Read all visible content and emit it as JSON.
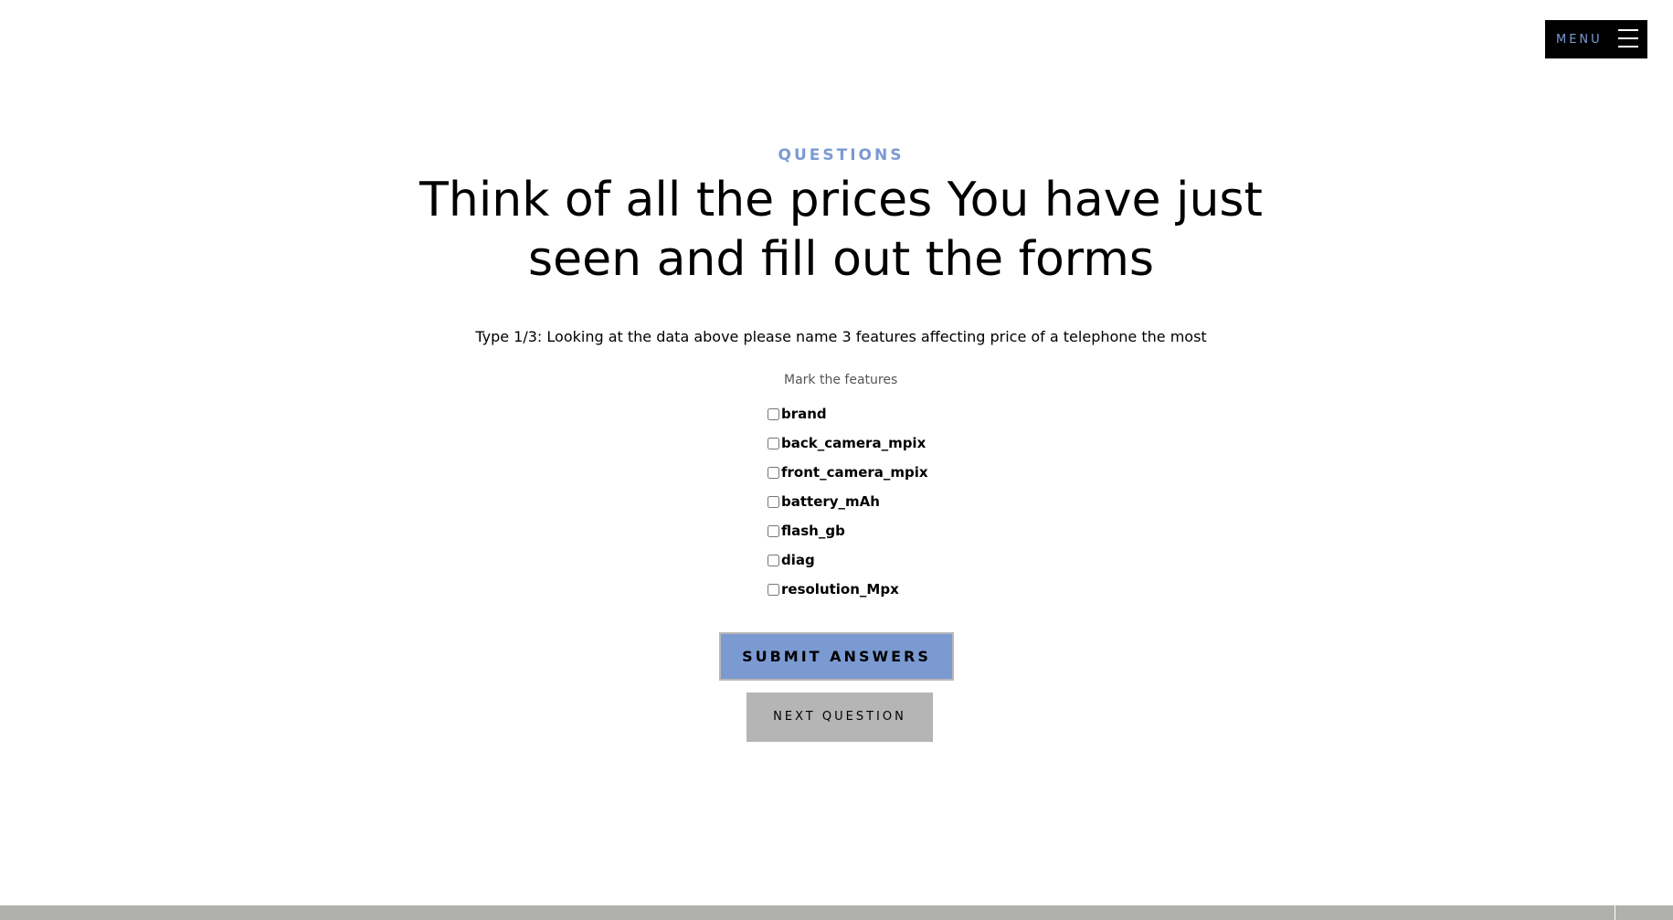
{
  "header": {
    "menu_label": "MENU",
    "menu_icon": "hamburger-icon"
  },
  "main": {
    "eyebrow": "QUESTIONS",
    "title": "Think of all the prices You have just seen and fill out the forms",
    "question": "Type 1/3: Looking at the data above please name 3 features affecting price of a telephone the most",
    "fieldset_legend": "Mark the features",
    "options": [
      {
        "label": "brand",
        "checked": false
      },
      {
        "label": "back_camera_mpix",
        "checked": false
      },
      {
        "label": "front_camera_mpix",
        "checked": false
      },
      {
        "label": "battery_mAh",
        "checked": false
      },
      {
        "label": "flash_gb",
        "checked": false
      },
      {
        "label": "diag",
        "checked": false
      },
      {
        "label": "resolution_Mpx",
        "checked": false
      }
    ],
    "submit_label": "SUBMIT ANSWERS",
    "next_label": "NEXT QUESTION"
  },
  "colors": {
    "accent": "#7b9ad2",
    "menu_bg": "#000000",
    "next_bg": "#b5b5b5",
    "footer_bg": "#b0b1ac"
  }
}
